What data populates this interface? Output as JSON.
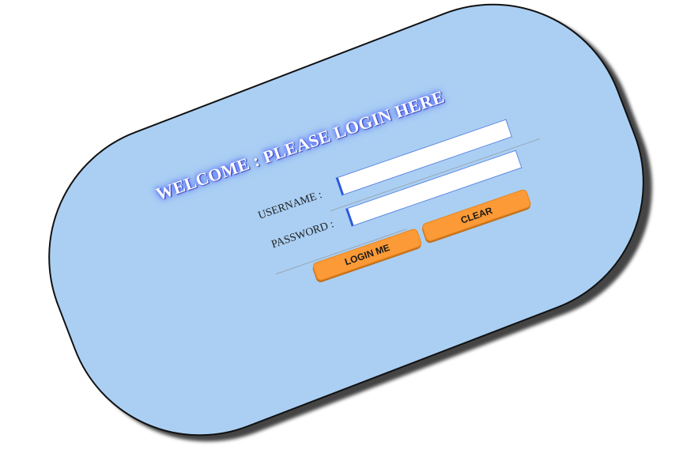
{
  "login": {
    "title": "WELCOME : PLEASE LOGIN HERE",
    "username_label": "USERNAME :",
    "username_value": "",
    "password_label": "PASSWORD :",
    "password_value": "",
    "login_button": "LOGIN ME",
    "clear_button": "CLEAR"
  },
  "colors": {
    "panel_background": "#aacff3",
    "panel_border": "#111111",
    "button_background": "#fb9a36",
    "title_glow": "#4a5cff"
  }
}
